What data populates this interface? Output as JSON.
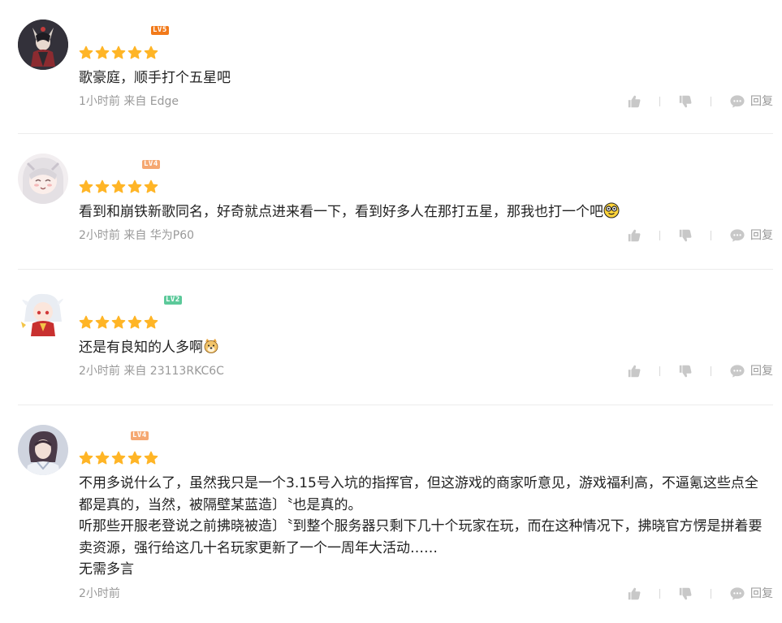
{
  "colors": {
    "star": "#FFB526",
    "lv5": "#F27A1A",
    "lv4": "#F5A872",
    "lv2": "#5CC99A",
    "icon_gray": "#C8C8C8",
    "text_meta": "#999999"
  },
  "comments": [
    {
      "level": "LV5",
      "stars": 5,
      "text": "歌豪庭，顺手打个五星吧",
      "time_source": "1小时前 来自 Edge",
      "reply_label": "回复"
    },
    {
      "level": "LV4",
      "stars": 5,
      "text": "看到和崩铁新歌同名，好奇就点进来看一下，看到好多人在那打五星，那我也打一个吧",
      "emoji": "sunglasses-emoji",
      "time_source": "2小时前 来自 华为P60",
      "reply_label": "回复"
    },
    {
      "level": "LV2",
      "stars": 5,
      "text": "还是有良知的人多啊",
      "emoji": "doge-emoji",
      "time_source": "2小时前 来自 23113RKC6C",
      "reply_label": "回复"
    },
    {
      "level": "LV4",
      "stars": 5,
      "text": "不用多说什么了，虽然我只是一个3.15号入坑的指挥官，但这游戏的商家听意见，游戏福利高，不逼氪这些点全都是真的，当然，被隔壁某蓝造〕〝也是真的。\n听那些开服老登说之前拂晓被造〕〝到整个服务器只剩下几十个玩家在玩，而在这种情况下，拂晓官方愣是拼着要卖资源，强行给这几十名玩家更新了一个一周年大活动……\n无需多言",
      "time_source": "2小时前",
      "reply_label": "回复"
    }
  ]
}
